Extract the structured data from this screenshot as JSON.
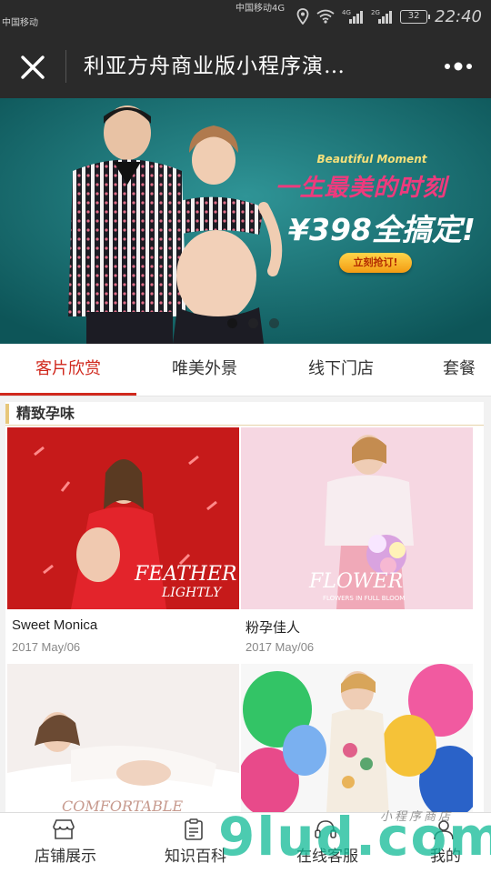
{
  "status_bar": {
    "carrier_1": "中国移动4G",
    "carrier_2": "中国移动",
    "battery": "32",
    "time": "22:40"
  },
  "nav": {
    "title": "利亚方舟商业版小程序演…"
  },
  "banner": {
    "tagline_en": "Beautiful Moment",
    "headline": "一生最美的时刻",
    "price_text": "¥398全搞定!",
    "cta": "立刻抢订!",
    "dots_count": 3,
    "active_dot": 0
  },
  "tabs": [
    "客片欣赏",
    "唯美外景",
    "线下门店",
    "套餐"
  ],
  "section": {
    "title": "精致孕味"
  },
  "cards": [
    {
      "name": "Sweet Monica",
      "date": "2017 May/06",
      "photo_text": "FEATHER",
      "photo_text_2": "LIGHTLY"
    },
    {
      "name": "粉孕佳人",
      "date": "2017 May/06",
      "photo_text": "FLOWER",
      "photo_text_2": "FLOWERS IN FULL BLOOM"
    },
    {
      "name": "",
      "date": "",
      "photo_text": "COMFORTABLE",
      "photo_text_2": ""
    },
    {
      "name": "",
      "date": "",
      "photo_text": "",
      "photo_text_2": ""
    }
  ],
  "bottom_nav": [
    {
      "label": "店铺展示",
      "icon": "store-icon"
    },
    {
      "label": "知识百科",
      "icon": "clipboard-icon"
    },
    {
      "label": "在线客服",
      "icon": "headset-icon"
    },
    {
      "label": "我的",
      "icon": "user-icon"
    }
  ],
  "watermark": {
    "big": "9lud.com",
    "small": "小程序商店"
  },
  "colors": {
    "accent": "#d0281d",
    "nav_bg": "#2a2a2a",
    "section_bar": "#e7c77a"
  }
}
